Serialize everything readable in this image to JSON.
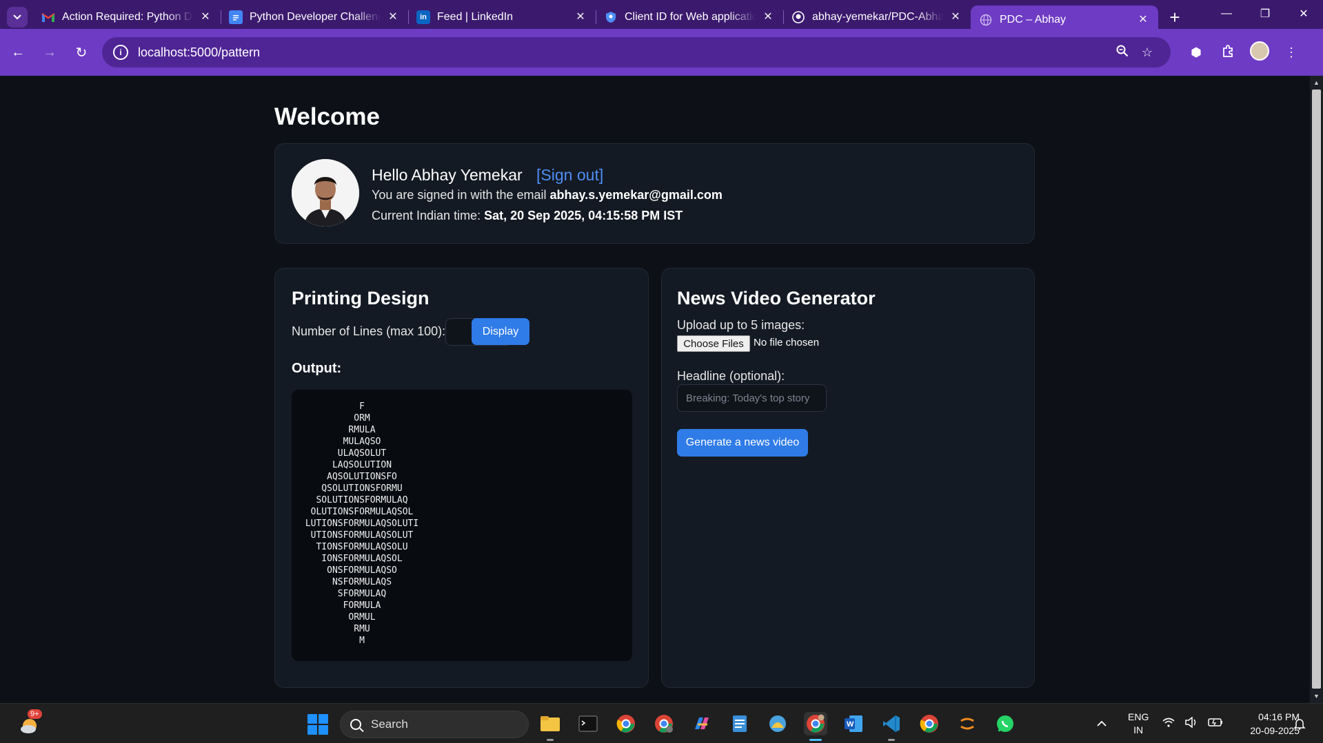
{
  "browser": {
    "tabs": [
      {
        "label": "Action Required: Python Developer Challenge",
        "icon": "gmail-icon",
        "active": false
      },
      {
        "label": "Python Developer Challenge",
        "icon": "docs-icon",
        "active": false
      },
      {
        "label": "Feed | LinkedIn",
        "icon": "linkedin-icon",
        "active": false
      },
      {
        "label": "Client ID for Web application",
        "icon": "shield-icon",
        "active": false
      },
      {
        "label": "abhay-yemekar/PDC-Abhay",
        "icon": "github-icon",
        "active": false
      },
      {
        "label": "PDC – Abhay",
        "icon": "globe-icon",
        "active": true
      }
    ],
    "url": "localhost:5000/pattern",
    "colors": {
      "tabstrip": "#3b1a6e",
      "toolbar": "#6e3bc4",
      "omnibox": "#4f2596"
    }
  },
  "page": {
    "welcome": "Welcome",
    "user": {
      "hello": "Hello Abhay Yemekar",
      "signout": "[Sign out]",
      "email_prefix": "You are signed in with the email",
      "email": "abhay.s.yemekar@gmail.com",
      "time_prefix": "Current Indian time:",
      "time": "Sat, 20 Sep 2025, 04:15:58 PM IST"
    },
    "printing": {
      "title": "Printing Design",
      "lines_label": "Number of Lines (max 100):",
      "lines_value": "",
      "display_button": "Display",
      "output_label": "Output:",
      "output_lines": [
        "F",
        "ORM",
        "RMULA",
        "MULAQSO",
        "ULAQSOLUT",
        "LAQSOLUTION",
        "AQSOLUTIONSFO",
        "QSOLUTIONSFORMU",
        "SOLUTIONSFORMULAQ",
        "OLUTIONSFORMULAQSOL",
        "LUTIONSFORMULAQSOLUTI",
        "UTIONSFORMULAQSOLUT",
        "TIONSFORMULAQSOLU",
        "IONSFORMULAQSOL",
        "ONSFORMULAQSO",
        "NSFORMULAQS",
        "SFORMULAQ",
        "FORMULA",
        "ORMUL",
        "RMU",
        "M"
      ]
    },
    "news": {
      "title": "News Video Generator",
      "upload_label": "Upload up to 5 images:",
      "choose_files": "Choose Files",
      "no_file": "No file chosen",
      "headline_label": "Headline (optional):",
      "headline_placeholder": "Breaking: Today's top story",
      "generate_button": "Generate a news video"
    },
    "colors": {
      "background": "#0d1117",
      "card": "#141a23",
      "accent": "#2f7be8",
      "link": "#4f8ef7"
    }
  },
  "taskbar": {
    "weather_badge": "9+",
    "search_label": "Search",
    "apps": [
      "file-explorer-icon",
      "terminal-icon",
      "chrome-icon",
      "chrome-profile-icon",
      "copilot-icon",
      "notepad-icon",
      "photos-icon",
      "chrome-active-icon",
      "word-icon",
      "vscode-icon",
      "chrome-alt-icon",
      "sublime-icon",
      "whatsapp-icon"
    ],
    "lang_top": "ENG",
    "lang_bottom": "IN",
    "time": "04:16 PM",
    "date": "20-09-2025"
  }
}
